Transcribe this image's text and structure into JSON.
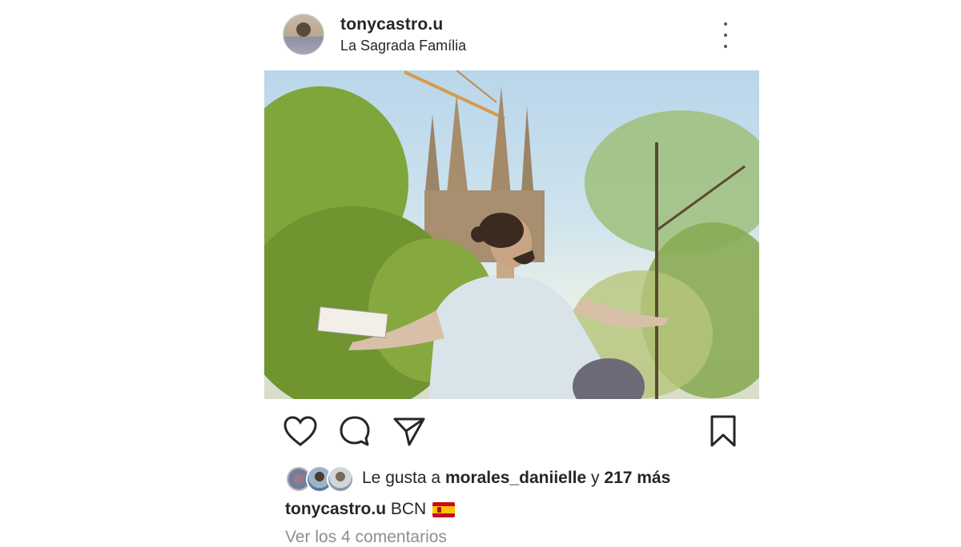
{
  "header": {
    "username": "tonycastro.u",
    "location": "La Sagrada Família",
    "more_icon": "more-vertical-icon"
  },
  "photo": {
    "description_icon": "photo"
  },
  "actions": {
    "like_icon": "heart-icon",
    "comment_icon": "comment-icon",
    "share_icon": "send-icon",
    "save_icon": "bookmark-icon"
  },
  "likes": {
    "prefix": "Le gusta a",
    "user": "morales_daniielle",
    "conjunction": "y",
    "count": "217 más"
  },
  "caption": {
    "username": "tonycastro.u",
    "text": "BCN"
  },
  "comments": {
    "link": "Ver los 4 comentarios"
  },
  "colors": {
    "text": "#262626",
    "muted": "#8e8e8e",
    "flag_red": "#c60b1e",
    "flag_yellow": "#ffc400"
  }
}
